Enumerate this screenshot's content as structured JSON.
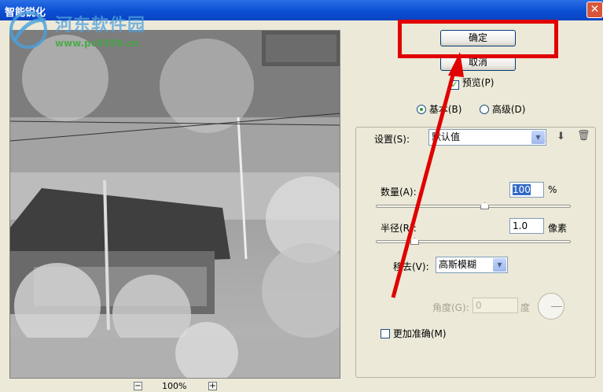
{
  "window": {
    "title": "智能锐化",
    "close_glyph": "✕"
  },
  "watermark": {
    "line1": "河东软件园",
    "line2": "www.pc0359.cn"
  },
  "zoom": {
    "minus": "−",
    "value": "100%",
    "plus": "+"
  },
  "buttons": {
    "ok": "确定",
    "cancel": "取消"
  },
  "preview": {
    "label": "预览(P)",
    "checked": true
  },
  "mode": {
    "basic_label": "基本(B)",
    "advanced_label": "高级(D)",
    "selected": "basic"
  },
  "settings": {
    "label": "设置(S):",
    "value": "默认值"
  },
  "amount": {
    "label": "数量(A):",
    "value": "100",
    "unit": "%",
    "slider_fraction": 0.5
  },
  "radius": {
    "label": "半径(R):",
    "value": "1.0",
    "unit": "像素",
    "slider_fraction": 0.22
  },
  "remove": {
    "label": "移去(V):",
    "value": "高斯模糊"
  },
  "angle": {
    "label": "角度(G):",
    "value": "0",
    "unit": "度"
  },
  "more_accurate": {
    "label": "更加准确(M)",
    "checked": false
  },
  "colors": {
    "annotation": "#e00000",
    "title_bar": "#0b4fd3"
  }
}
